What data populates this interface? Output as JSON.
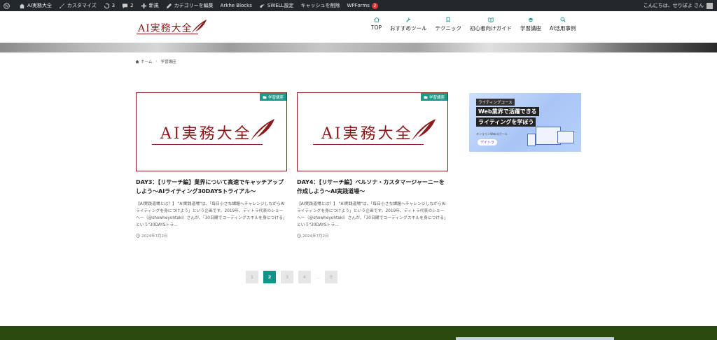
{
  "admin_bar": {
    "site_name": "AI実務大全",
    "customize": "カスタマイズ",
    "updates": "3",
    "comments": "2",
    "new": "新規",
    "edit_category": "カテゴリーを編集",
    "arkhe_blocks": "Arkhe Blocks",
    "swell_settings": "SWELL設定",
    "clear_cache": "キャッシュを削除",
    "wpforms": "WPForms",
    "wpforms_badge": "2",
    "greeting": "こんにちは、せりぽよ さん"
  },
  "header": {
    "logo_text": "AI実務大全",
    "nav": [
      {
        "label": "TOP",
        "icon": "home-icon"
      },
      {
        "label": "おすすめツール",
        "icon": "wrench-icon"
      },
      {
        "label": "テクニック",
        "icon": "bookmark-icon"
      },
      {
        "label": "初心者向けガイド",
        "icon": "book-icon"
      },
      {
        "label": "学習講座",
        "icon": "graduation-cap-icon"
      },
      {
        "label": "AI活用事例",
        "icon": "magnifier-icon"
      }
    ]
  },
  "breadcrumb": {
    "home": "ホーム",
    "current": "学習講座"
  },
  "posts": [
    {
      "category": "学習講座",
      "thumb_text": "AI実務大全",
      "title": "DAY3：【リサーチ編】業界について高速でキャッチアップしよう～AIライティング30DAYSトライアル～",
      "excerpt": "【AI実践道場とは？】 \"AI実践道場\"は、「毎日小さな課題へチャレンジしながらAIライティングを身につけよう」という企画です。2019年、ディトラ代表のショーヘー（@showheyohtaki）さんが、「30日間でコーディングスキルを身につける」という\"30DAYSトラ...",
      "date": "2024年7月2日"
    },
    {
      "category": "学習講座",
      "thumb_text": "AI実務大全",
      "title": "DAY4：【リサーチ編】ペルソナ・カスタマージャーニーを作成しよう～AI実践道場～",
      "excerpt": "【AI実践道場とは？】 \"AI実践道場\"は、「毎日小さな課題へチャレンジしながらAIライティングを身につけよう」という企画です。2019年、ディトラ代表のショーヘー（@showheyohtaki）さんが、「30日間でコーディングスキルを身につける」という\"30DAYSトラ...",
      "date": "2024年7月2日"
    }
  ],
  "sidebar_ad": {
    "tag": "ライティングコース",
    "line1": "Web業界で活躍できる",
    "line2": "ライティングを学ぼう",
    "small": "オンラインWebスクール",
    "logo": "デイトラ"
  },
  "pagination": {
    "pages": [
      "1",
      "2",
      "3",
      "4",
      "5"
    ],
    "current": "2",
    "dots": "…"
  },
  "colors": {
    "accent": "#119488",
    "brand": "#8b1a1a",
    "footer": "#2b4a10",
    "adminbar": "#23282d"
  }
}
